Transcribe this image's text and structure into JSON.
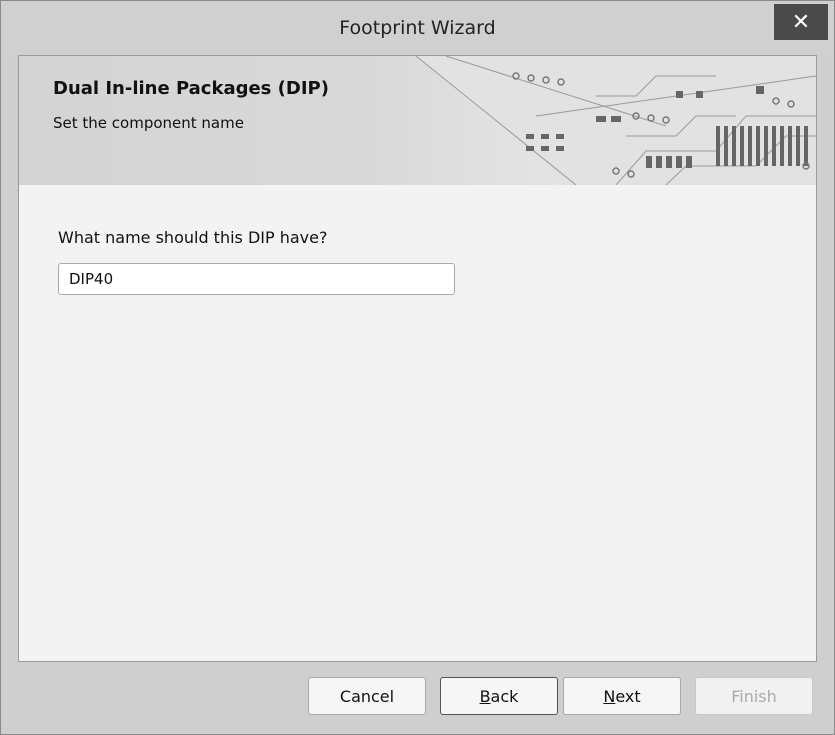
{
  "window": {
    "title": "Footprint Wizard",
    "close_glyph": "✕"
  },
  "banner": {
    "title": "Dual In-line Packages (DIP)",
    "subtitle": "Set the component name"
  },
  "form": {
    "question": "What name should this DIP have?",
    "name_value": "DIP40"
  },
  "buttons": {
    "cancel": "Cancel",
    "back_mnemonic": "B",
    "back_rest": "ack",
    "next_mnemonic": "N",
    "next_rest": "ext",
    "finish": "Finish"
  },
  "icons": {
    "close": "close-icon",
    "banner_art": "pcb-circuit-icon"
  }
}
